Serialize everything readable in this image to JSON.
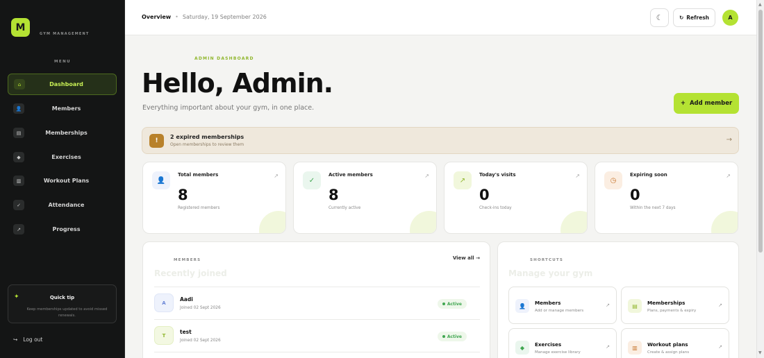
{
  "sidebar": {
    "logo": "M",
    "brand": "GYM MANAGEMENT",
    "menu_heading": "MENU",
    "items": [
      {
        "label": "Dashboard",
        "icon": "⌂",
        "icon_name": "home-icon"
      },
      {
        "label": "Members",
        "icon": "👤",
        "icon_name": "user-icon"
      },
      {
        "label": "Memberships",
        "icon": "▤",
        "icon_name": "card-icon"
      },
      {
        "label": "Exercises",
        "icon": "◆",
        "icon_name": "dumbbell-icon"
      },
      {
        "label": "Workout Plans",
        "icon": "▥",
        "icon_name": "clipboard-icon"
      },
      {
        "label": "Attendance",
        "icon": "✓",
        "icon_name": "check-icon"
      },
      {
        "label": "Progress",
        "icon": "↗",
        "icon_name": "trend-icon"
      }
    ],
    "tip_star": "✦",
    "tip_title": "Quick tip",
    "tip_text": "Keep memberships updated to avoid missed renewals.",
    "logout_icon": "↪",
    "logout": "Log out"
  },
  "topbar": {
    "crumb": "Overview",
    "separator": "•",
    "date": "Saturday, 19 September 2026",
    "theme_icon": "☾",
    "refresh_icon": "↻",
    "refresh": "Refresh",
    "avatar": "A"
  },
  "hero": {
    "eyebrow": "ADMIN DASHBOARD",
    "title": "Hello, Admin.",
    "subtitle": "Everything important about your gym, in one place.",
    "add_icon": "+",
    "add_member": "Add member"
  },
  "alert": {
    "icon": "!",
    "title": "2 expired memberships",
    "subtitle": "Open memberships to review them",
    "arrow": "→"
  },
  "stats": [
    {
      "label": "Total members",
      "value": "8",
      "sub": "Registered members",
      "icon": "👤",
      "icon_name": "user-icon",
      "color": "#eef2fc",
      "fg": "#6b86d6"
    },
    {
      "label": "Active members",
      "value": "8",
      "sub": "Currently active",
      "icon": "✓",
      "icon_name": "check-icon",
      "color": "#eaf6ee",
      "fg": "#3fa650"
    },
    {
      "label": "Today's visits",
      "value": "0",
      "sub": "Check-ins today",
      "icon": "↗",
      "icon_name": "trend-icon",
      "color": "#f1f7dc",
      "fg": "#8fb62c"
    },
    {
      "label": "Expiring soon",
      "value": "0",
      "sub": "Within the next 7 days",
      "icon": "◷",
      "icon_name": "clock-icon",
      "color": "#fbeee2",
      "fg": "#c7762e"
    }
  ],
  "stat_arrow": "↗",
  "members": {
    "eyebrow": "MEMBERS",
    "title": "Recently joined",
    "view_all": "View all →",
    "rows": [
      {
        "initial": "A",
        "name": "Aadi",
        "joined": "Joined 02 Sept 2026",
        "status": "Active"
      },
      {
        "initial": "T",
        "name": "test",
        "joined": "Joined 02 Sept 2026",
        "status": "Active"
      }
    ]
  },
  "shortcuts": {
    "eyebrow": "SHORTCUTS",
    "title": "Manage your gym",
    "arrow": "↗",
    "items": [
      {
        "title": "Members",
        "sub": "Add or manage members",
        "icon": "👤",
        "icon_name": "user-icon"
      },
      {
        "title": "Memberships",
        "sub": "Plans, payments & expiry",
        "icon": "▤",
        "icon_name": "card-icon"
      },
      {
        "title": "Exercises",
        "sub": "Manage exercise library",
        "icon": "◆",
        "icon_name": "dumbbell-icon"
      },
      {
        "title": "Workout plans",
        "sub": "Create & assign plans",
        "icon": "▥",
        "icon_name": "clipboard-icon"
      }
    ]
  },
  "colors": {
    "accent": "#b4e233",
    "sidebar_bg": "#141515",
    "warning": "#b8812a"
  }
}
